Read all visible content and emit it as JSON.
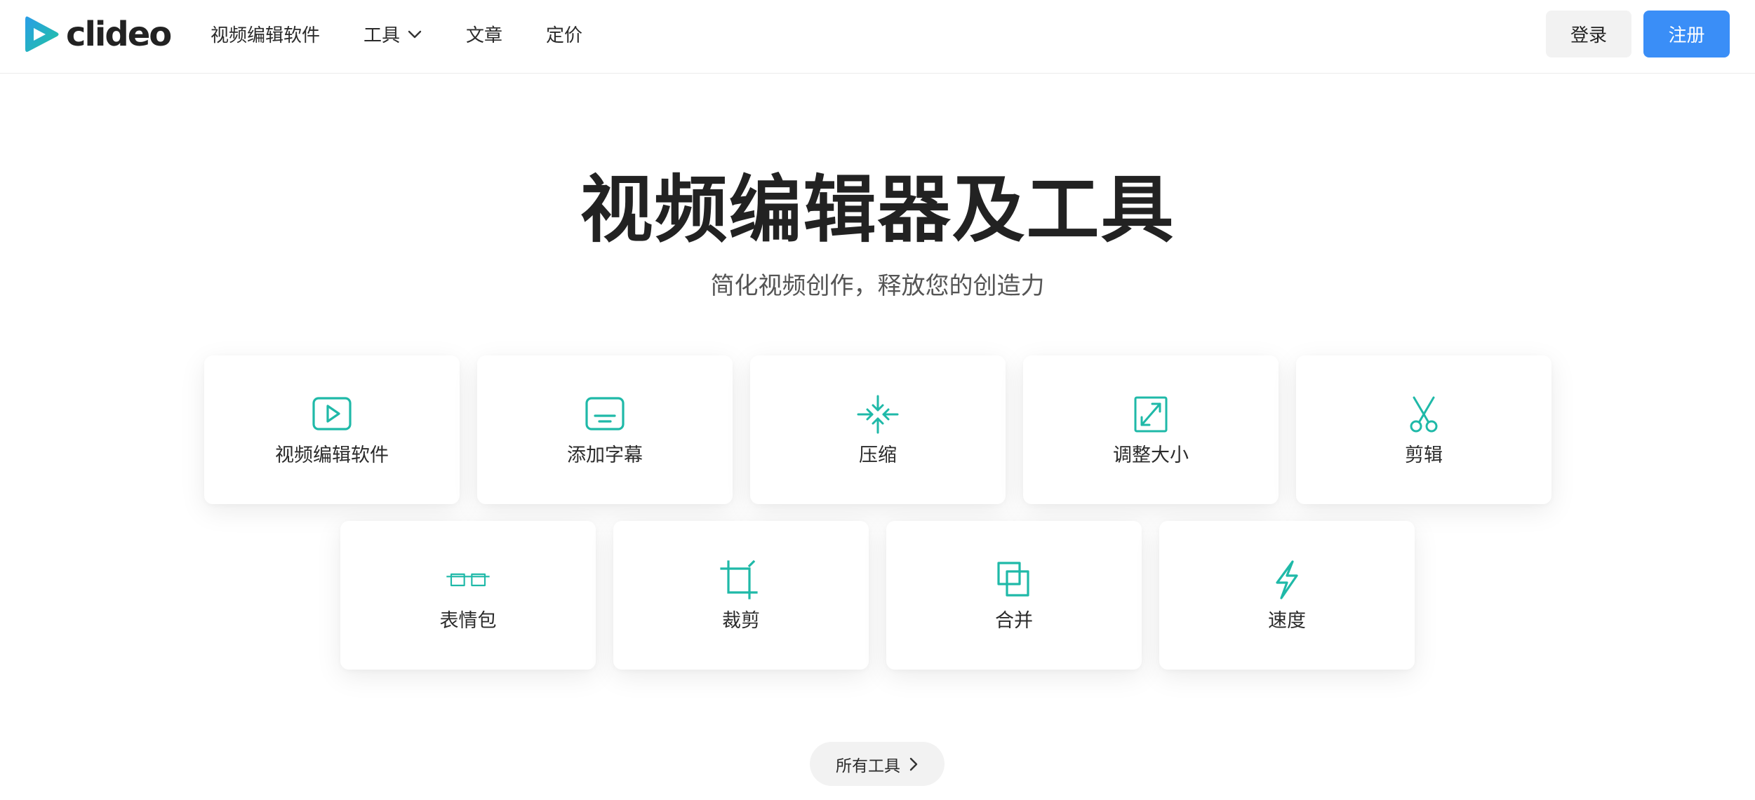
{
  "brand": {
    "name": "clideo",
    "accent": "#1fbfa6",
    "primary_button": "#3a8ef7"
  },
  "nav": {
    "items": [
      {
        "label": "视频编辑软件"
      },
      {
        "label": "工具",
        "has_dropdown": true
      },
      {
        "label": "文章"
      },
      {
        "label": "定价"
      }
    ]
  },
  "auth": {
    "login_label": "登录",
    "signup_label": "注册"
  },
  "hero": {
    "title": "视频编辑器及工具",
    "subtitle": "简化视频创作，释放您的创造力"
  },
  "tools": [
    {
      "label": "视频编辑软件",
      "icon": "play-icon"
    },
    {
      "label": "添加字幕",
      "icon": "subtitles-icon"
    },
    {
      "label": "压缩",
      "icon": "compress-icon"
    },
    {
      "label": "调整大小",
      "icon": "resize-icon"
    },
    {
      "label": "剪辑",
      "icon": "scissors-icon"
    },
    {
      "label": "表情包",
      "icon": "glasses-icon"
    },
    {
      "label": "裁剪",
      "icon": "crop-icon"
    },
    {
      "label": "合并",
      "icon": "merge-icon"
    },
    {
      "label": "速度",
      "icon": "lightning-icon"
    }
  ],
  "all_tools": {
    "label": "所有工具"
  }
}
